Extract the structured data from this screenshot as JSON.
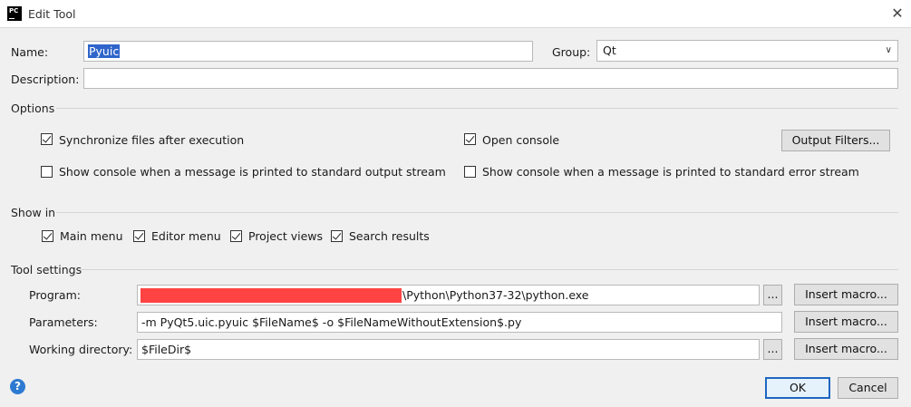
{
  "window": {
    "title": "Edit Tool",
    "app_icon": "pycharm-icon",
    "close_icon": "close-icon"
  },
  "form": {
    "name_label": "Name:",
    "name_value": "Pyuic",
    "group_label": "Group:",
    "group_value": "Qt",
    "description_label": "Description:",
    "description_value": ""
  },
  "options": {
    "title": "Options",
    "sync_files": {
      "label": "Synchronize files after execution",
      "checked": true
    },
    "open_console": {
      "label": "Open console",
      "checked": true
    },
    "output_filters_button": "Output Filters...",
    "show_console_stdout": {
      "label": "Show console when a message is printed to standard output stream",
      "checked": false
    },
    "show_console_stderr": {
      "label": "Show console when a message is printed to standard error stream",
      "checked": false
    }
  },
  "show_in": {
    "title": "Show in",
    "items": [
      {
        "label": "Main menu",
        "checked": true
      },
      {
        "label": "Editor menu",
        "checked": true
      },
      {
        "label": "Project views",
        "checked": true
      },
      {
        "label": "Search results",
        "checked": true
      }
    ]
  },
  "tool_settings": {
    "title": "Tool settings",
    "program_label": "Program:",
    "program_value": "\\Python\\Python37-32\\python.exe",
    "parameters_label": "Parameters:",
    "parameters_value": "-m PyQt5.uic.pyuic $FileName$ -o $FileNameWithoutExtension$.py",
    "working_dir_label": "Working directory:",
    "working_dir_value": "$FileDir$",
    "browse_label": "...",
    "insert_macro_label": "Insert macro..."
  },
  "footer": {
    "help_icon": "help-icon",
    "ok_label": "OK",
    "cancel_label": "Cancel"
  },
  "colors": {
    "accent": "#2f65ca",
    "redaction": "#ff4343",
    "help": "#2d7ad2"
  }
}
